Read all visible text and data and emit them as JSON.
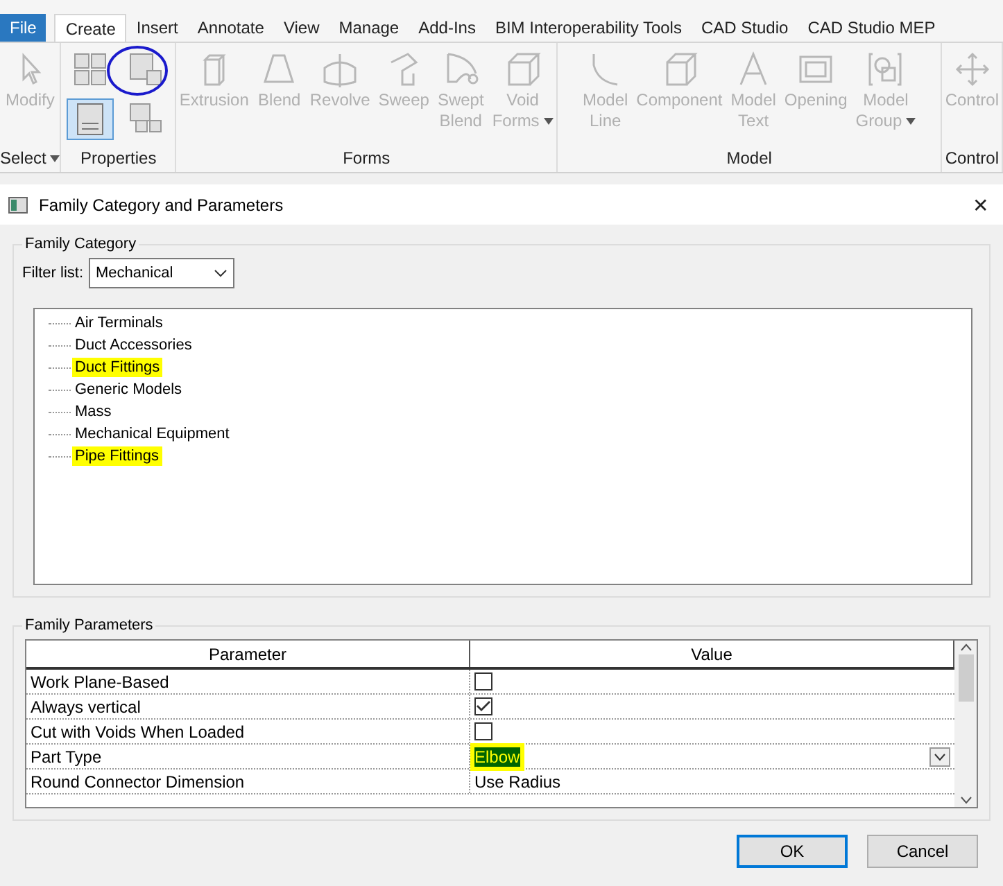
{
  "ribbon": {
    "file_tab": "File",
    "tabs": [
      {
        "label": "Create",
        "selected": true
      },
      {
        "label": "Insert",
        "selected": false
      },
      {
        "label": "Annotate",
        "selected": false
      },
      {
        "label": "View",
        "selected": false
      },
      {
        "label": "Manage",
        "selected": false
      },
      {
        "label": "Add-Ins",
        "selected": false
      },
      {
        "label": "BIM Interoperability Tools",
        "selected": false
      },
      {
        "label": "CAD Studio",
        "selected": false
      },
      {
        "label": "CAD Studio MEP",
        "selected": false
      }
    ],
    "panels": [
      {
        "title": "Select",
        "dropdown": true,
        "tools": [
          {
            "kind": "pointer",
            "label": "Modify",
            "dropdown": false
          }
        ]
      },
      {
        "title": "Properties",
        "dropdown": false,
        "tools": [
          {
            "kind": "grid",
            "selected": false
          },
          {
            "kind": "types",
            "selected": false,
            "circled": true
          },
          {
            "kind": "props",
            "selected": true
          },
          {
            "kind": "grid2",
            "selected": false
          }
        ]
      },
      {
        "title": "Forms",
        "dropdown": false,
        "tools": [
          {
            "kind": "extrusion",
            "label": "Extrusion",
            "dropdown": false
          },
          {
            "kind": "blend",
            "label": "Blend",
            "dropdown": false
          },
          {
            "kind": "revolve",
            "label": "Revolve",
            "dropdown": false
          },
          {
            "kind": "sweep",
            "label": "Sweep",
            "dropdown": false
          },
          {
            "kind": "sweptblend",
            "label": "Swept Blend",
            "dropdown": false
          },
          {
            "kind": "void",
            "label": "Void Forms",
            "dropdown": true
          }
        ]
      },
      {
        "title": "Model",
        "dropdown": false,
        "tools": [
          {
            "kind": "line",
            "label": "Model Line",
            "dropdown": false
          },
          {
            "kind": "component",
            "label": "Component",
            "dropdown": false
          },
          {
            "kind": "text",
            "label": "Model Text",
            "dropdown": false
          },
          {
            "kind": "opening",
            "label": "Opening",
            "dropdown": false
          },
          {
            "kind": "group",
            "label": "Model Group",
            "dropdown": true
          }
        ]
      },
      {
        "title": "Control",
        "dropdown": false,
        "tools": [
          {
            "kind": "control",
            "label": "Control",
            "dropdown": false
          }
        ]
      }
    ]
  },
  "dialog": {
    "title": "Family Category and Parameters",
    "close": "✕",
    "category": {
      "legend": "Family Category",
      "filter_label": "Filter list:",
      "filter_value": "Mechanical",
      "items": [
        {
          "label": "Air Terminals",
          "highlighted": false
        },
        {
          "label": "Duct Accessories",
          "highlighted": false
        },
        {
          "label": "Duct Fittings",
          "highlighted": true
        },
        {
          "label": "Generic Models",
          "highlighted": false
        },
        {
          "label": "Mass",
          "highlighted": false
        },
        {
          "label": "Mechanical Equipment",
          "highlighted": false
        },
        {
          "label": "Pipe Fittings",
          "highlighted": true
        }
      ]
    },
    "parameters": {
      "legend": "Family Parameters",
      "columns": [
        "Parameter",
        "Value"
      ],
      "rows": [
        {
          "name": "Work Plane-Based",
          "kind": "checkbox",
          "checked": false
        },
        {
          "name": "Always vertical",
          "kind": "checkbox",
          "checked": true
        },
        {
          "name": "Cut with Voids When Loaded",
          "kind": "checkbox",
          "checked": false
        },
        {
          "name": "Part Type",
          "kind": "dropdown",
          "value": "Elbow",
          "highlighted": true
        },
        {
          "name": "Round Connector Dimension",
          "kind": "text",
          "value": "Use Radius"
        }
      ]
    },
    "buttons": [
      {
        "label": "OK",
        "default": true
      },
      {
        "label": "Cancel",
        "default": false
      }
    ]
  }
}
